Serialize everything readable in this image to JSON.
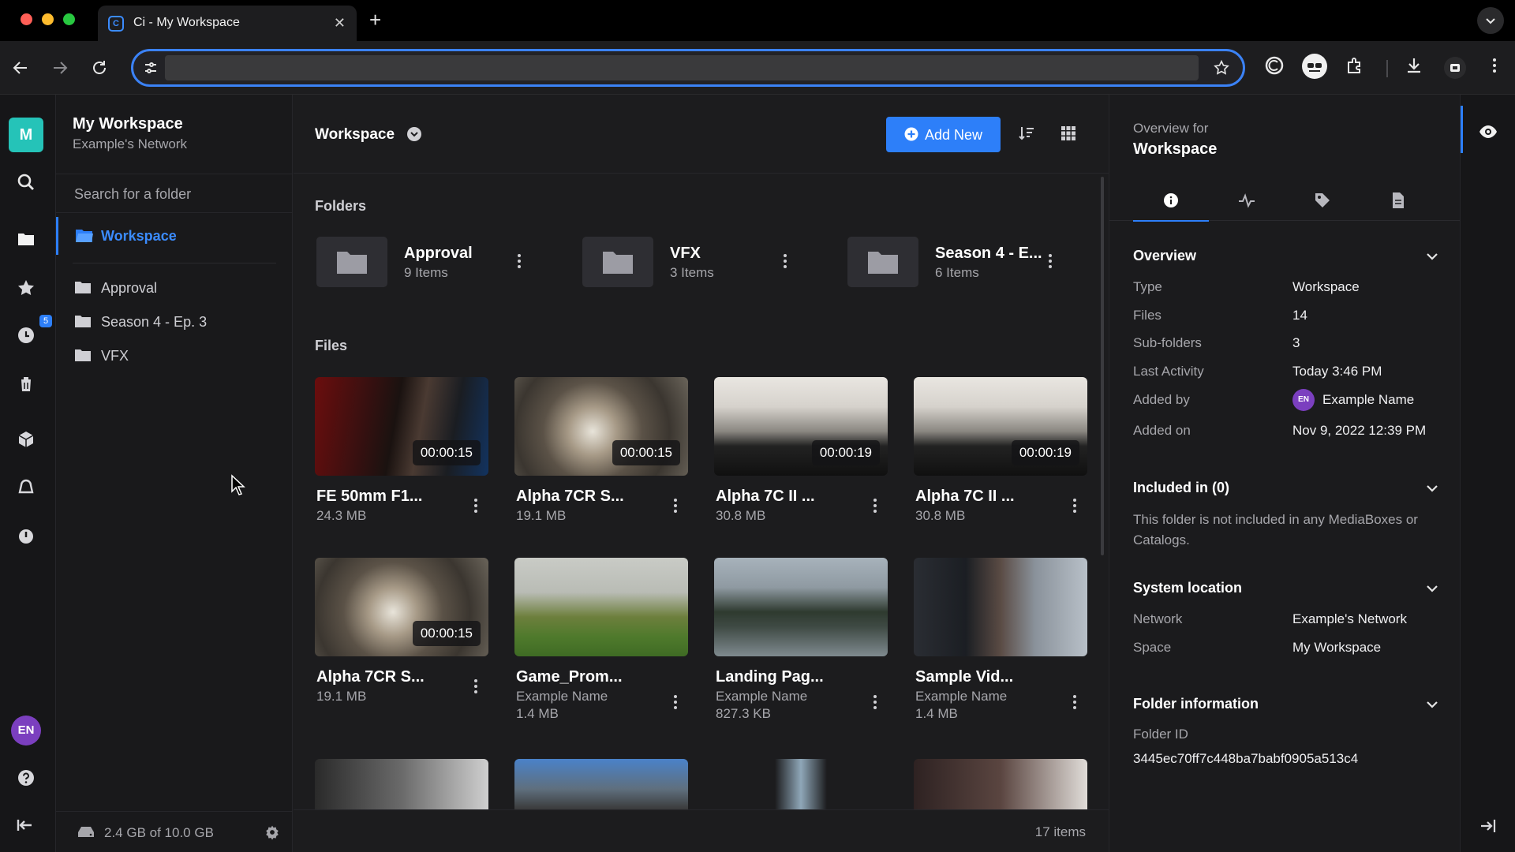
{
  "browser": {
    "tab_title": "Ci - My Workspace",
    "tab_favicon": "C",
    "close_symbol": "✕",
    "new_tab_symbol": "+",
    "address": "",
    "accent": "#3b82f6"
  },
  "rail": {
    "logo_letter": "M",
    "recent_badge": "5",
    "user_initials": "EN",
    "icons": [
      "search-icon",
      "folder-icon",
      "star-icon",
      "clock-icon",
      "trash-icon",
      "cube-icon",
      "cloud-icon",
      "power-icon",
      "help-icon",
      "collapse-icon"
    ]
  },
  "tree": {
    "workspace_title": "My Workspace",
    "network": "Example's Network",
    "search_placeholder": "Search for a folder",
    "root": "Workspace",
    "items": [
      "Approval",
      "Season 4 - Ep. 3",
      "VFX"
    ],
    "storage": "2.4 GB of 10.0 GB"
  },
  "main": {
    "title": "Workspace",
    "add_new": "Add New",
    "folders_label": "Folders",
    "files_label": "Files",
    "folders": [
      {
        "name": "Approval",
        "count": "9 Items"
      },
      {
        "name": "VFX",
        "count": "3 Items"
      },
      {
        "name": "Season 4 - E...",
        "count": "6 Items"
      }
    ],
    "files": [
      {
        "name": "FE 50mm F1...",
        "meta1": "24.3 MB",
        "meta2": "",
        "duration": "00:00:15"
      },
      {
        "name": "Alpha 7CR S...",
        "meta1": "19.1 MB",
        "meta2": "",
        "duration": "00:00:15"
      },
      {
        "name": "Alpha 7C II ...",
        "meta1": "30.8 MB",
        "meta2": "",
        "duration": "00:00:19"
      },
      {
        "name": "Alpha 7C II ...",
        "meta1": "30.8 MB",
        "meta2": "",
        "duration": "00:00:19"
      },
      {
        "name": "Alpha 7CR S...",
        "meta1": "19.1 MB",
        "meta2": "",
        "duration": "00:00:15"
      },
      {
        "name": "Game_Prom...",
        "meta1": "Example Name",
        "meta2": "1.4 MB",
        "duration": ""
      },
      {
        "name": "Landing Pag...",
        "meta1": "Example Name",
        "meta2": "827.3 KB",
        "duration": ""
      },
      {
        "name": "Sample Vid...",
        "meta1": "Example Name",
        "meta2": "1.4 MB",
        "duration": ""
      }
    ],
    "item_count": "17 items"
  },
  "details": {
    "overview_for": "Overview for",
    "name": "Workspace",
    "tabs": [
      "info-icon",
      "activity-icon",
      "tag-icon",
      "document-icon"
    ],
    "overview": {
      "heading": "Overview",
      "rows": [
        {
          "k": "Type",
          "v": "Workspace"
        },
        {
          "k": "Files",
          "v": "14"
        },
        {
          "k": "Sub-folders",
          "v": "3"
        },
        {
          "k": "Last Activity",
          "v": "Today 3:46 PM"
        },
        {
          "k": "Added by",
          "v": "Example Name"
        },
        {
          "k": "Added on",
          "v": "Nov 9, 2022 12:39 PM"
        }
      ],
      "added_by_initials": "EN"
    },
    "included": {
      "heading": "Included in (0)",
      "note": "This folder is not included in any MediaBoxes or Catalogs."
    },
    "location": {
      "heading": "System location",
      "rows": [
        {
          "k": "Network",
          "v": "Example's Network"
        },
        {
          "k": "Space",
          "v": "My Workspace"
        }
      ]
    },
    "folder_info": {
      "heading": "Folder information",
      "id_label": "Folder ID",
      "id_value": "3445ec70ff7c448ba7babf0905a513c4"
    }
  }
}
